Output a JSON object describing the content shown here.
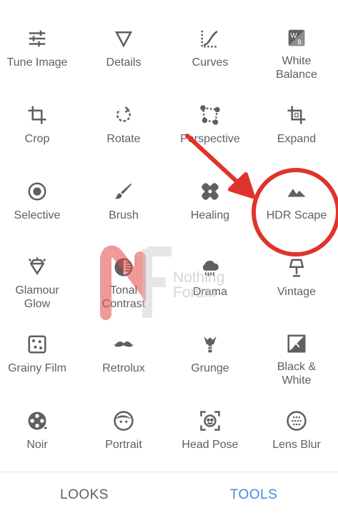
{
  "tools": [
    {
      "label": "Tune Image",
      "icon": "tune-sliders-icon"
    },
    {
      "label": "Details",
      "icon": "details-triangle-icon"
    },
    {
      "label": "Curves",
      "icon": "curves-icon"
    },
    {
      "label": "White\nBalance",
      "icon": "white-balance-icon"
    },
    {
      "label": "Crop",
      "icon": "crop-icon"
    },
    {
      "label": "Rotate",
      "icon": "rotate-icon"
    },
    {
      "label": "Perspective",
      "icon": "perspective-icon"
    },
    {
      "label": "Expand",
      "icon": "expand-icon"
    },
    {
      "label": "Selective",
      "icon": "selective-icon"
    },
    {
      "label": "Brush",
      "icon": "brush-icon"
    },
    {
      "label": "Healing",
      "icon": "healing-bandage-icon"
    },
    {
      "label": "HDR Scape",
      "icon": "mountains-icon"
    },
    {
      "label": "Glamour\nGlow",
      "icon": "diamond-icon"
    },
    {
      "label": "Tonal\nContrast",
      "icon": "tonal-contrast-icon"
    },
    {
      "label": "Drama",
      "icon": "cloud-drama-icon"
    },
    {
      "label": "Vintage",
      "icon": "lamp-icon"
    },
    {
      "label": "Grainy Film",
      "icon": "dice-grain-icon"
    },
    {
      "label": "Retrolux",
      "icon": "mustache-icon"
    },
    {
      "label": "Grunge",
      "icon": "guitar-icon"
    },
    {
      "label": "Black &\nWhite",
      "icon": "black-white-icon"
    },
    {
      "label": "Noir",
      "icon": "film-reel-icon"
    },
    {
      "label": "Portrait",
      "icon": "face-icon"
    },
    {
      "label": "Head Pose",
      "icon": "head-pose-icon"
    },
    {
      "label": "Lens Blur",
      "icon": "lens-blur-icon"
    }
  ],
  "tabs": {
    "looks": "LOOKS",
    "tools": "TOOLS"
  },
  "watermark": {
    "text": "Nothing\nForum"
  },
  "colors": {
    "accent": "#3f8ae0",
    "annotation": "#e0332a",
    "icon": "#5f5f5f"
  }
}
